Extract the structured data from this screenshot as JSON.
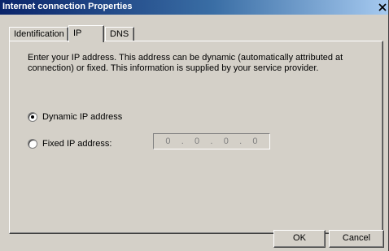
{
  "window": {
    "title": "Internet connection Properties",
    "close_label": "X"
  },
  "tabs": [
    {
      "label": "Identification",
      "active": false
    },
    {
      "label": "IP",
      "active": true
    },
    {
      "label": "DNS",
      "active": false
    }
  ],
  "panel": {
    "description": "Enter your IP address. This address can be dynamic (automatically attributed at connection) or fixed. This information is supplied by your service provider.",
    "dynamic_option": {
      "label": "Dynamic IP address",
      "selected": true
    },
    "fixed_option": {
      "label": "Fixed IP address:",
      "selected": false
    },
    "ip_address": {
      "octets": [
        "0",
        "0",
        "0",
        "0"
      ],
      "separator": ".",
      "enabled": false
    }
  },
  "buttons": {
    "ok": "OK",
    "cancel": "Cancel"
  },
  "colors": {
    "titlebar_start": "#0a246a",
    "titlebar_end": "#a6caf0",
    "face": "#d4d0c8",
    "disabled_text": "#808080"
  },
  "icons": {
    "close": "close-icon",
    "radio": "radio-button"
  }
}
